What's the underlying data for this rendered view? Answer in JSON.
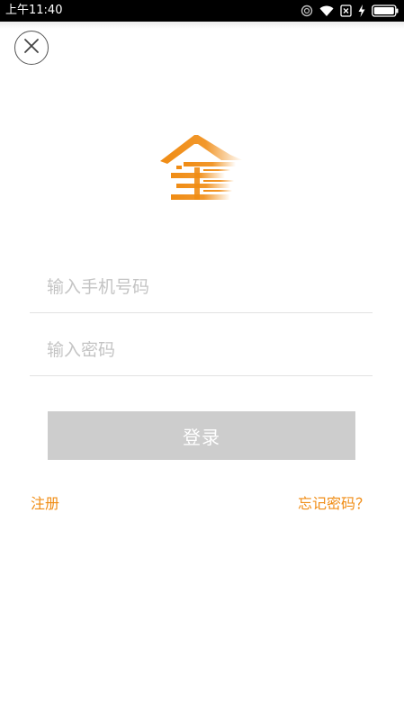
{
  "status_bar": {
    "time": "上午11:40",
    "icons": [
      "alarm-icon",
      "wifi-icon",
      "no-sim-icon",
      "charging-icon",
      "battery-icon"
    ]
  },
  "colors": {
    "accent": "#f08c14",
    "button_disabled": "#cdcdcd",
    "placeholder": "#c4c4c4",
    "divider": "#e2e2e2"
  },
  "header": {
    "close_icon": "close-icon"
  },
  "logo": {
    "icon": "house-logo-icon"
  },
  "form": {
    "phone_placeholder": "输入手机号码",
    "phone_value": "",
    "password_placeholder": "输入密码",
    "password_value": "",
    "login_label": "登录"
  },
  "links": {
    "register": "注册",
    "forgot_password": "忘记密码？"
  }
}
